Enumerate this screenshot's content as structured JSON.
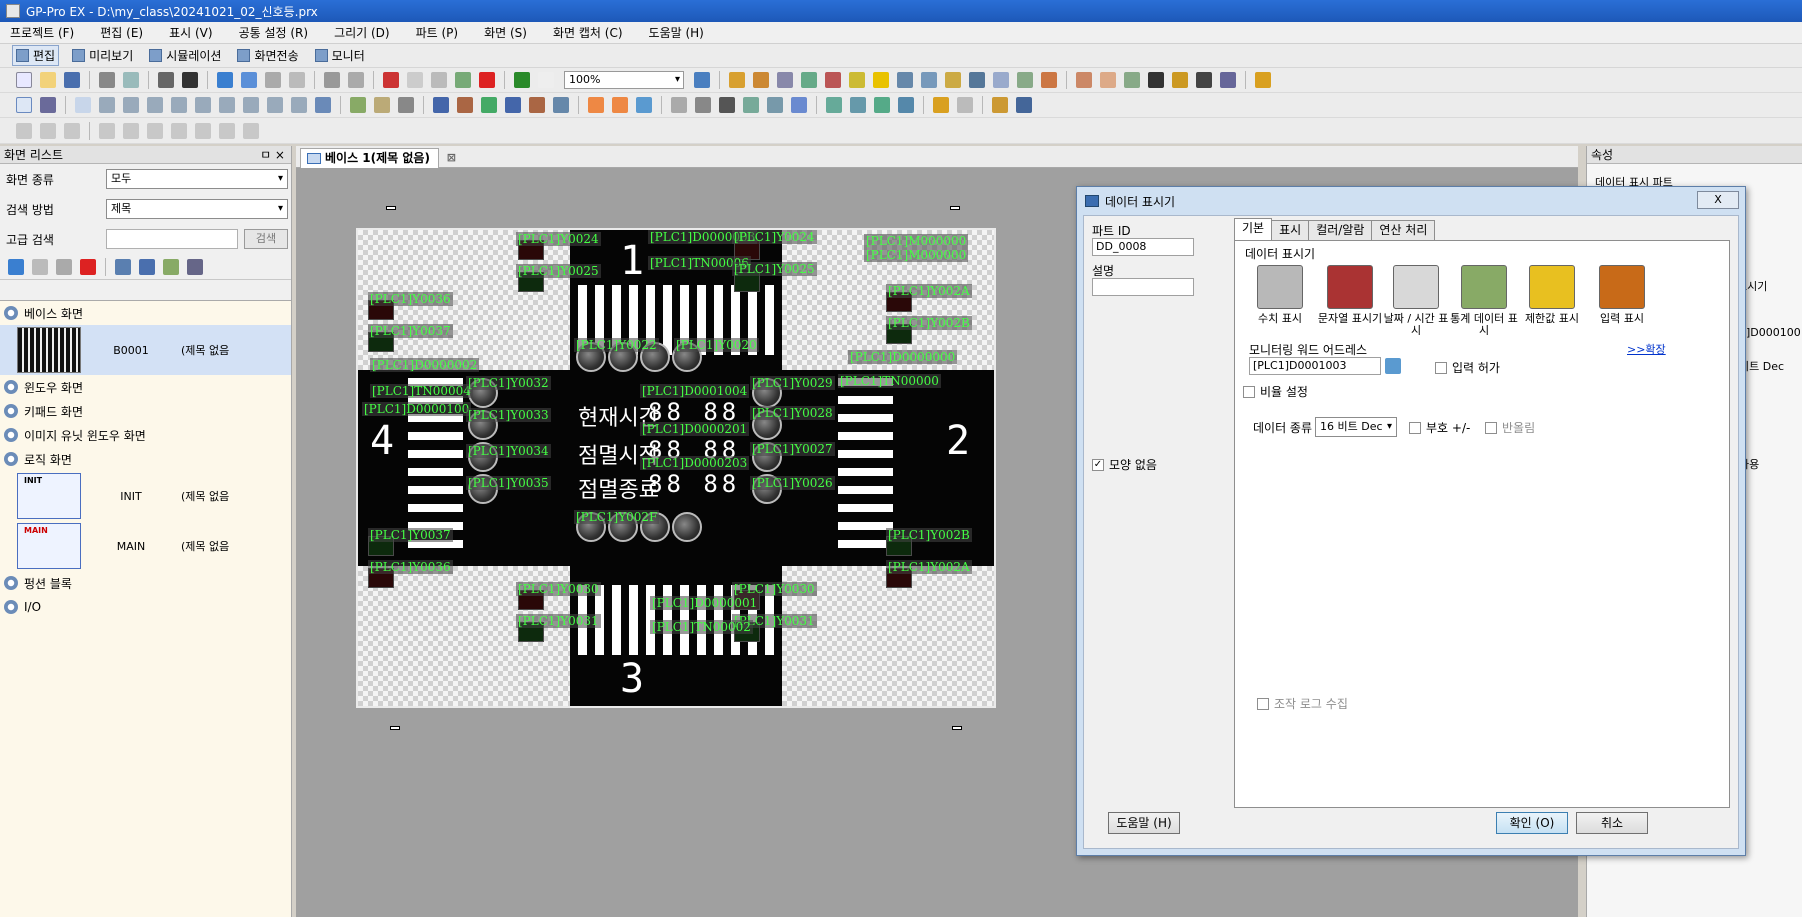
{
  "window": {
    "title": "GP-Pro EX - D:\\my_class\\20241021_02_신호등.prx"
  },
  "menu": [
    "프로젝트 (F)",
    "편집 (E)",
    "표시 (V)",
    "공통 설정 (R)",
    "그리기 (D)",
    "파트 (P)",
    "화면 (S)",
    "화면 캡처 (C)",
    "도움말 (H)"
  ],
  "modes": [
    "편집",
    "미리보기",
    "시뮬레이션",
    "화면전송",
    "모니터"
  ],
  "toolbar": {
    "zoom": "100%"
  },
  "left_panel": {
    "title": "화면 리스트",
    "pin": "ㅁ ×",
    "screen_type_label": "화면 종류",
    "screen_type_value": "모두",
    "search_method_label": "검색 방법",
    "search_method_value": "제목",
    "advanced_label": "고급 검색",
    "search_button": "검색",
    "tree": {
      "base": "베이스 화면",
      "base_item": {
        "code": "B0001",
        "desc": "(제목 없음"
      },
      "window": "윈도우 화면",
      "keypad": "키패드 화면",
      "image_unit": "이미지 유닛 윈도우 화면",
      "logic": "로직 화면",
      "logic_items": [
        {
          "thumb": "INIT",
          "code": "INIT",
          "desc": "(제목 없음"
        },
        {
          "thumb": "MAIN",
          "code": "MAIN",
          "desc": "(제목 없음"
        }
      ],
      "function_block": "펑션 블록",
      "io": "I/O"
    }
  },
  "editor": {
    "tab_title": "베이스 1(제목 없음)"
  },
  "canvas": {
    "road_numbers": [
      "1",
      "2",
      "3",
      "4"
    ],
    "kr_texts": [
      "현재시간",
      "점멸시작",
      "점멸종료"
    ],
    "digit_pairs": [
      "88 88",
      "88 88",
      "88 88"
    ],
    "labels": [
      "[PLC1]Y0024",
      "[PLC1]Y0025",
      "[PLC1]D0000003",
      "[PLC1]TN00006",
      "[PLC1]Y0024",
      "[PLC1]Y0025",
      "[PLC1]M000000",
      "[PLC1]M000000",
      "[PLC1]Y0036",
      "[PLC1]Y0037",
      "[PLC1]Y002A",
      "[PLC1]Y002B",
      "[PLC1]D0000002",
      "[PLC1]TN00004",
      "[PLC1]D0000100",
      "[PLC1]Y0032",
      "[PLC1]Y0033",
      "[PLC1]Y0034",
      "[PLC1]Y0035",
      "[PLC1]Y0022",
      "[PLC1]Y0020",
      "[PLC1]D0001004",
      "[PLC1]D0000201",
      "[PLC1]D0000203",
      "[PLC1]Y0029",
      "[PLC1]Y0028",
      "[PLC1]Y0027",
      "[PLC1]Y0026",
      "[PLC1]D0000000",
      "[PLC1]TN00000",
      "[PLC1]Y002F",
      "[PLC1]Y0037",
      "[PLC1]Y0036",
      "[PLC1]Y002B",
      "[PLC1]Y002A",
      "[PLC1]Y0030",
      "[PLC1]Y0031",
      "[PLC1]Y0030",
      "[PLC1]Y0031",
      "[PLC1]D0000001",
      "[PLC1]TN00002"
    ]
  },
  "right_panel": {
    "title": "속성",
    "lines": [
      "데이터 표시 파트",
      "표시기",
      "1]D000100",
      "비트 Dec",
      "사용"
    ]
  },
  "dialog": {
    "title": "데이터 표시기",
    "close": "X",
    "part_id_label": "파트 ID",
    "part_id_value": "DD_0008",
    "comment_label": "설명",
    "no_shape_label": "모양 없음",
    "tabs": [
      "기본",
      "표시",
      "컬러/알람",
      "연산 처리"
    ],
    "section_title": "데이터 표시기",
    "types": [
      "수치 표시",
      "문자열 표시기",
      "날짜 / 시간 표시",
      "통계 데이터 표시",
      "제한값 표시",
      "입력 표시"
    ],
    "monitor_label": "모니터링 워드 어드레스",
    "monitor_value": "[PLC1]D0001003",
    "expand_link": ">>확장",
    "input_allow": "입력 허가",
    "scale_setting": "비율 설정",
    "data_type_label": "데이터 종류",
    "data_type_value": "16 비트 Dec",
    "sign": "부호 +/-",
    "round": "반올림",
    "log_collect": "조작 로그 수집",
    "help_button": "도움말 (H)",
    "ok_button": "확인 (O)",
    "cancel_button": "취소"
  },
  "colors": {
    "titlebar": "#1d58b8",
    "label_green": "#44ff44",
    "link": "#0033cc"
  }
}
